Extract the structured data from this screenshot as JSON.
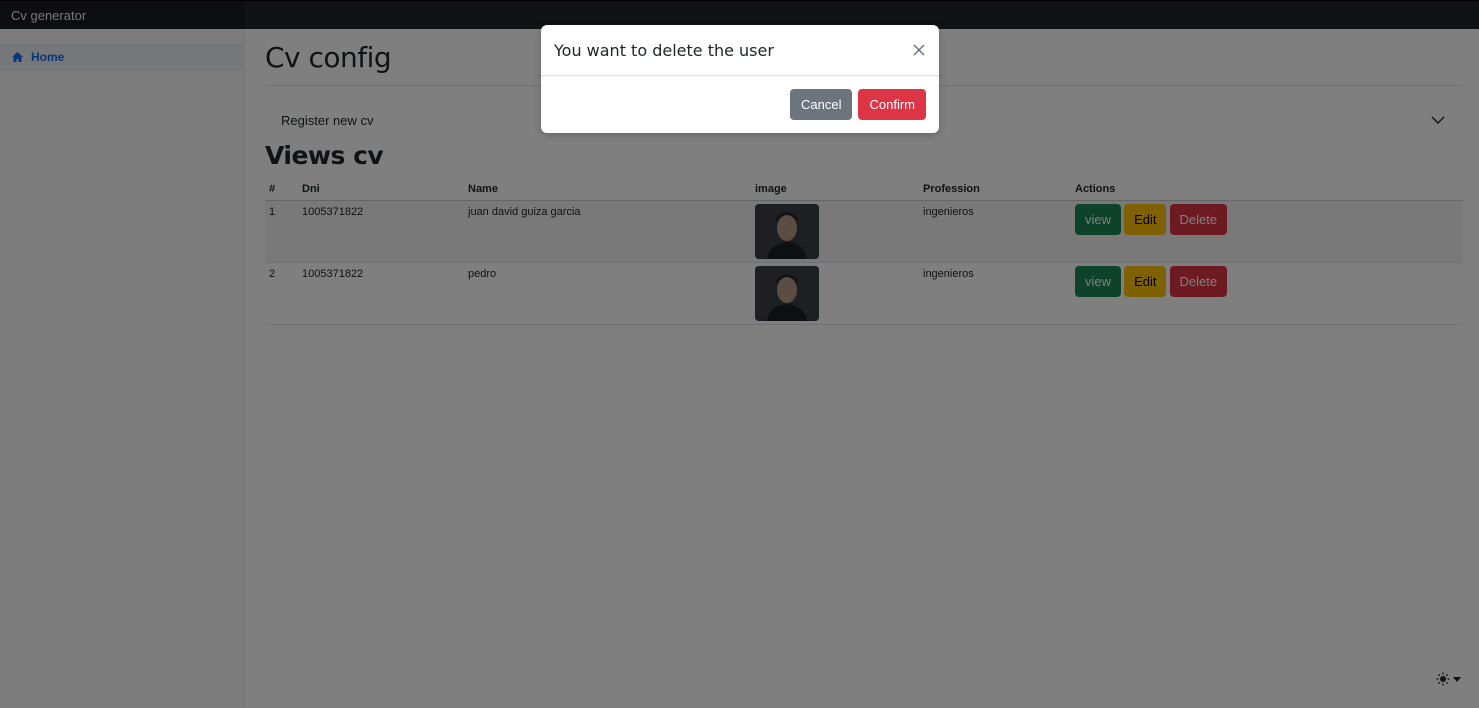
{
  "app": {
    "brand": "Cv generator"
  },
  "sidebar": {
    "items": [
      {
        "label": "Home",
        "icon": "home-icon"
      }
    ]
  },
  "main": {
    "page_title": "Cv config",
    "accordion_label": "Register new cv",
    "section_title": "Views cv"
  },
  "table": {
    "headers": [
      "#",
      "Dni",
      "Name",
      "image",
      "Profession",
      "Actions"
    ],
    "rows": [
      {
        "num": "1",
        "dni": "1005371822",
        "name": "juan david guiza garcia",
        "profession": "ingenieros"
      },
      {
        "num": "2",
        "dni": "1005371822",
        "name": "pedro",
        "profession": "ingenieros"
      }
    ],
    "actions": {
      "view": "view",
      "edit": "Edit",
      "delete": "Delete"
    }
  },
  "modal": {
    "title": "You want to delete the user",
    "cancel": "Cancel",
    "confirm": "Confirm"
  },
  "colors": {
    "primary": "#0d6efd",
    "success": "#198754",
    "warning": "#ffc107",
    "danger": "#dc3545",
    "secondary": "#6c757d",
    "navbar": "#212529"
  }
}
